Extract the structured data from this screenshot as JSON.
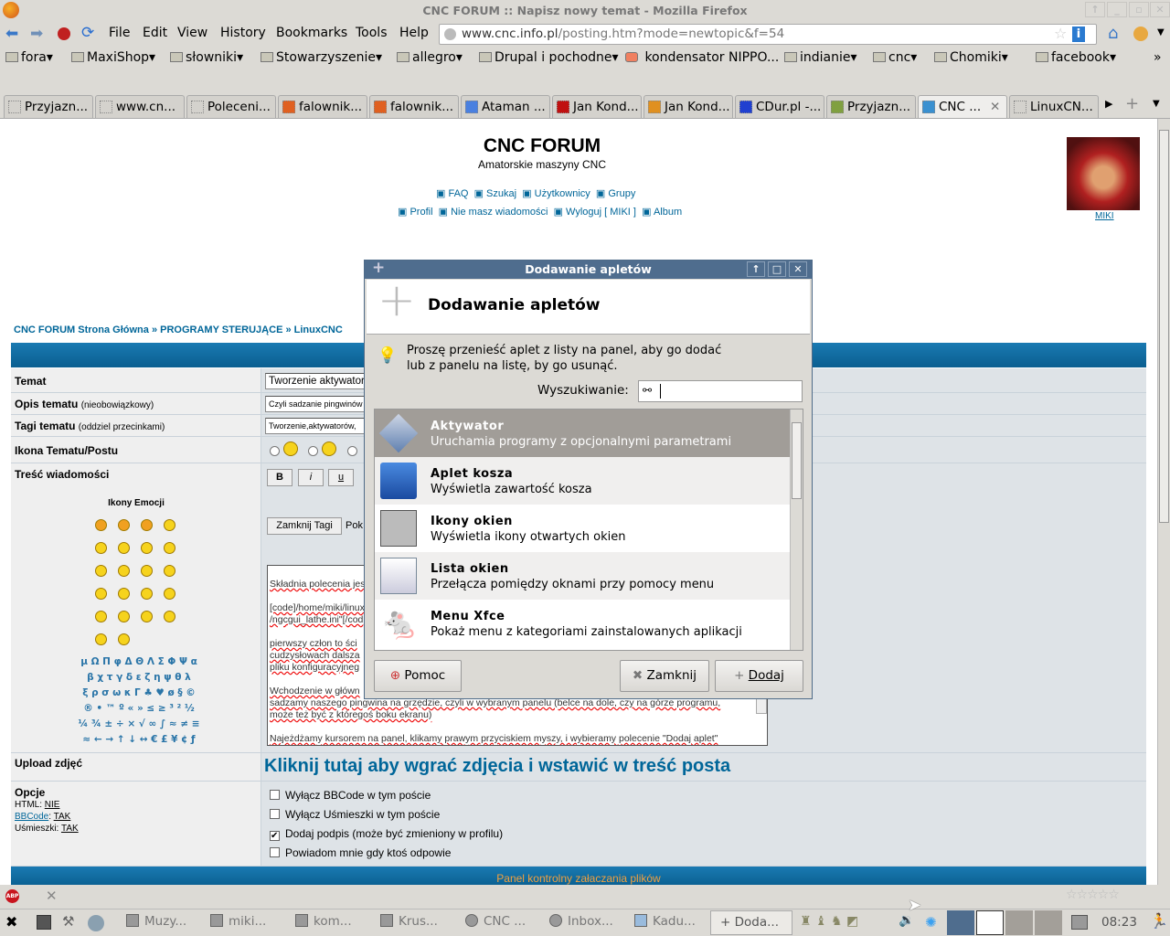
{
  "window": {
    "title": "CNC FORUM :: Napisz nowy temat - Mozilla Firefox"
  },
  "menu": [
    "File",
    "Edit",
    "View",
    "History",
    "Bookmarks",
    "Tools",
    "Help"
  ],
  "url": {
    "host": "www.cnc.info.pl",
    "path": "/posting.htm?mode=newtopic&f=54"
  },
  "bookmarks": [
    "fora",
    "MaxiShop",
    "słowniki",
    "Stowarzyszenie",
    "allegro",
    "Drupal i pochodne",
    "kondensator NIPPO...",
    "indianie",
    "cnc",
    "Chomiki",
    "facebook"
  ],
  "bookmarks_more": "»",
  "tabs": [
    "Przyjazn...",
    "www.cn...",
    "Poleceni...",
    "falownik...",
    "falownik...",
    "Ataman ...",
    "Jan Kond...",
    "Jan Kond...",
    "CDur.pl -...",
    "Przyjazn...",
    "CNC ...",
    "LinuxCN..."
  ],
  "active_tab": 10,
  "forum": {
    "title": "CNC FORUM",
    "subtitle": "Amatorskie maszyny CNC",
    "nav1": [
      "FAQ",
      "Szukaj",
      "Użytkownicy",
      "Grupy"
    ],
    "nav2": [
      "Profil",
      "Nie masz wiadomości",
      "Wyloguj [ MIKI ]",
      "Album"
    ],
    "user": "MIKI",
    "breadcrumb": [
      "CNC FORUM Strona Główna",
      "»",
      "PROGRAMY STERUJĄCE",
      "»",
      "LinuxCNC"
    ],
    "labels": {
      "temat": "Temat",
      "opis": "Opis tematu",
      "opis_note": "(nieobowiązkowy)",
      "tagi": "Tagi tematu",
      "tagi_note": "(oddziel przecinkami)",
      "ikona": "Ikona Tematu/Postu",
      "tresc": "Treść wiadomości",
      "emocje": "Ikony Emocji",
      "upload": "Upload zdjęć",
      "opcje": "Opcje"
    },
    "values": {
      "temat": "Tworzenie aktywatore",
      "opis": "Czyli sadzanie pingwinów",
      "tagi": "Tworzenie,aktywatorów,"
    },
    "format_buttons": [
      "B",
      "i",
      "u"
    ],
    "close_tags": "Zamknij Tagi",
    "close_tags_after": "Pok",
    "chars": [
      "μ Ω Π φ Δ Θ Λ Σ Φ Ψ α",
      "β χ τ γ δ ε ζ η ψ θ λ",
      "ξ ρ σ ω κ Γ ♣ ♥ ø § ©",
      "® • ™ º « » ≤ ≥ ³ ² ½",
      "¼ ¾ ± ÷ × √ ∞ ∫ ≈ ≠ ≡",
      "≈ ← → ↑ ↓ ↔ € £ ¥ ¢ ƒ"
    ],
    "message": [
      "Składnia polecenia jes",
      "[code]/home/miki/linux",
      "/ngcgui_lathe.ini\"[/cod",
      "pierwszy człon to ści",
      "cudzysłowach dalsza",
      "pliku konfiguracyjneg",
      "Wchodzenie w główn",
      "sadzamy naszego pingwina na grzędzie, czyli w wybranym panelu (belce na dole, czy na górze programu,",
      "może też być z któregoś boku ekranu)",
      "Najeżdżamy kursorem na panel, klikamy prawym przyciskiem myszy, i wybieramy polecenie \"Dodaj aplet\""
    ],
    "upload_link": "Kliknij tutaj aby wgrać zdjęcia i wstawić w treść posta",
    "opts_status": {
      "html": "HTML:",
      "html_v": "NIE",
      "bbcode": "BBCode",
      "bbcode_v": "TAK",
      "smiles": "Uśmieszki:",
      "smiles_v": "TAK"
    },
    "options": [
      {
        "label": "Wyłącz BBCode w tym poście",
        "checked": false
      },
      {
        "label": "Wyłącz Uśmieszki w tym poście",
        "checked": false
      },
      {
        "label": "Dodaj podpis (może być zmieniony w profilu)",
        "checked": true
      },
      {
        "label": "Powiadom mnie gdy ktoś odpowie",
        "checked": false
      }
    ],
    "attach_panel": "Panel kontrolny załaczania plików"
  },
  "dialog": {
    "title": "Dodawanie apletów",
    "heading": "Dodawanie apletów",
    "hint1": "Proszę przenieść aplet z listy na panel, aby go dodać",
    "hint2": "lub z panelu na listę, by go usunąć.",
    "search_label": "Wyszukiwanie:",
    "search_value": "",
    "items": [
      {
        "name": "Aktywator",
        "desc": "Uruchamia programy z opcjonalnymi parametrami"
      },
      {
        "name": "Aplet kosza",
        "desc": "Wyświetla zawartość kosza"
      },
      {
        "name": "Ikony okien",
        "desc": "Wyświetla ikony otwartych okien"
      },
      {
        "name": "Lista okien",
        "desc": "Przełącza pomiędzy oknami przy pomocy menu"
      },
      {
        "name": "Menu Xfce",
        "desc": "Pokaż menu z kategoriami zainstalowanych aplikacji"
      }
    ],
    "buttons": {
      "help": "Pomoc",
      "close": "Zamknij",
      "add": "Dodaj"
    }
  },
  "taskbar": {
    "items": [
      "Muzy...",
      "miki...",
      "kom...",
      "Krus...",
      "CNC ...",
      "Inbox...",
      "Kadu...",
      "Doda..."
    ],
    "clock": "08:23"
  },
  "colors": {
    "forum_blue": "#006699",
    "header_bar": "#0d6aa0",
    "dialog_title": "#4f6d8e",
    "selected": "#a19d98"
  }
}
